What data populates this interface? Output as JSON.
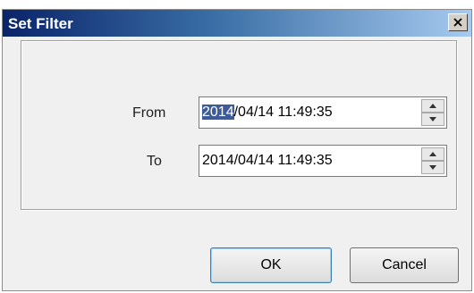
{
  "dialog": {
    "title": "Set Filter",
    "close_label": "X"
  },
  "fields": {
    "from": {
      "label": "From",
      "value_selected": "2014",
      "value_rest": "/04/14 11:49:35"
    },
    "to": {
      "label": "To",
      "value": "2014/04/14 11:49:35"
    }
  },
  "buttons": {
    "ok": "OK",
    "cancel": "Cancel"
  },
  "colors": {
    "titlebar_start": "#0a246a",
    "selection": "#3d5a99"
  },
  "icons": {
    "close": "close-icon",
    "spin_up": "arrow-up-icon",
    "spin_down": "arrow-down-icon"
  }
}
